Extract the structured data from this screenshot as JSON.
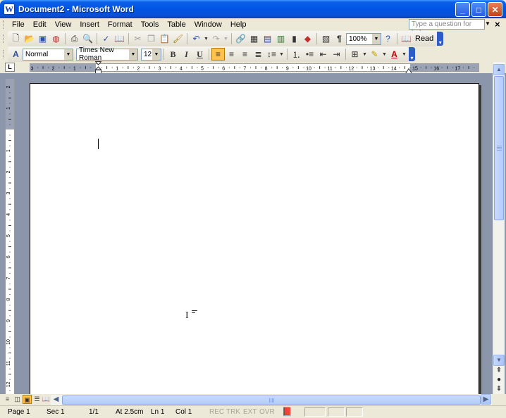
{
  "window": {
    "title": "Document2 - Microsoft Word",
    "icon": "word-app-icon",
    "minimize": "_",
    "maximize": "□",
    "close": "✕"
  },
  "menu": {
    "items": [
      "File",
      "Edit",
      "View",
      "Insert",
      "Format",
      "Tools",
      "Table",
      "Window",
      "Help"
    ],
    "help_placeholder": "Type a question for help",
    "close_doc": "×"
  },
  "standard_toolbar": {
    "zoom": "100%",
    "read_label": "Read",
    "icons": [
      "new-icon",
      "open-icon",
      "save-icon",
      "permission-icon",
      "print-icon",
      "print-preview-icon",
      "spelling-icon",
      "research-icon",
      "cut-icon",
      "copy-icon",
      "paste-icon",
      "format-painter-icon",
      "undo-icon",
      "redo-icon",
      "hyperlink-icon",
      "tables-borders-icon",
      "insert-table-icon",
      "excel-icon",
      "columns-icon",
      "drawing-icon",
      "document-map-icon",
      "show-hide-icon",
      "help-icon"
    ]
  },
  "formatting_toolbar": {
    "style": "Normal",
    "font": "Times New Roman",
    "size": "12",
    "bold": "B",
    "italic": "I",
    "underline": "U"
  },
  "ruler": {
    "h_labels": [
      "3",
      "2",
      "1",
      "1",
      "2",
      "3",
      "4",
      "5",
      "6",
      "7",
      "8",
      "9",
      "10",
      "11",
      "12",
      "13",
      "14",
      "15",
      "16",
      "17"
    ],
    "v_labels": [
      "2",
      "1",
      "1",
      "2",
      "3",
      "4",
      "5",
      "6",
      "7",
      "8",
      "9",
      "10",
      "11",
      "12"
    ],
    "tab_selector": "L"
  },
  "status": {
    "page": "Page 1",
    "sec": "Sec 1",
    "pages": "1/1",
    "at": "At 2.5cm",
    "ln": "Ln 1",
    "col": "Col 1",
    "rec": "REC",
    "trk": "TRK",
    "ext": "EXT",
    "ovr": "OVR"
  }
}
